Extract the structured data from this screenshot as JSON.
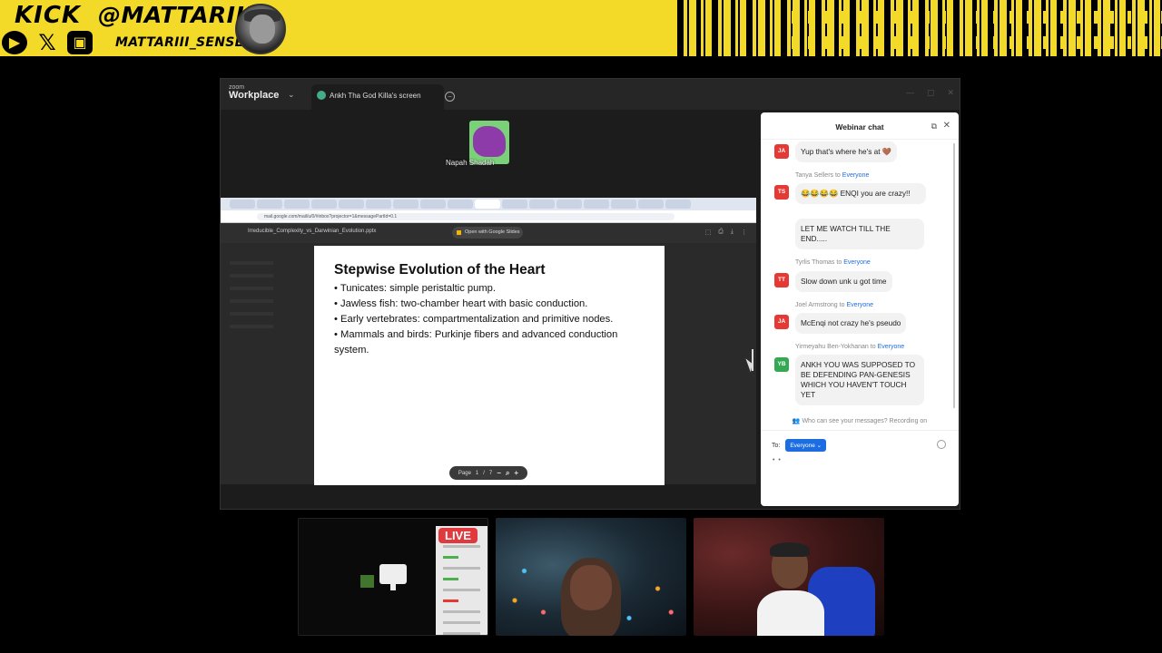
{
  "banner": {
    "platform": "KICK",
    "handle": "@MATTARIII",
    "handle_secondary": "MATTARIII_SENSEI",
    "social_icons": [
      "youtube-icon",
      "x-icon",
      "twitch-icon"
    ],
    "background_color": "#f4da28"
  },
  "zoom": {
    "logo_small": "zoom",
    "logo_big": "Workplace",
    "tab_label": "Ankh Tha God Killa's screen",
    "speaker_name": "Napah Shadah"
  },
  "browser": {
    "url": "mail.google.com/mail/u/0/#inbox?projector=1&messagePartId=0.1",
    "file_name": "Irreducible_Complexity_vs_Darwinian_Evolution.pptx",
    "open_with": "Open with Google Slides"
  },
  "slide": {
    "title": "Stepwise Evolution of the Heart",
    "bullets": [
      "• Tunicates: simple peristaltic pump.",
      "• Jawless fish: two-chamber heart with basic conduction.",
      "• Early vertebrates: compartmentalization and primitive nodes.",
      "• Mammals and birds: Purkinje fibers and advanced conduction system."
    ],
    "pager": {
      "label": "Page",
      "current": "1",
      "separator": "/",
      "total": "7"
    }
  },
  "chat": {
    "title": "Webinar chat",
    "messages": [
      {
        "sender": "",
        "initials": "JA",
        "color": "#e53935",
        "to": "",
        "text": "Yup that's where he's at 🤎"
      },
      {
        "sender": "Tanya Sellers",
        "initials": "TS",
        "color": "#e53935",
        "to": "Everyone",
        "text": "😂😂😂😂 ENQI you are crazy!!"
      },
      {
        "sender": "",
        "initials": "",
        "color": "#e53935",
        "to": "",
        "text": "LET ME WATCH TILL THE END....."
      },
      {
        "sender": "Tyrlis Thomas",
        "initials": "TT",
        "color": "#e53935",
        "to": "Everyone",
        "text": "Slow down unk u got time"
      },
      {
        "sender": "Joel Armstrong",
        "initials": "JA",
        "color": "#e53935",
        "to": "Everyone",
        "text": "McEnqi not crazy he's pseudo"
      },
      {
        "sender": "Yirmeyahu Ben-Yokhanan",
        "initials": "YB",
        "color": "#34a853",
        "to": "Everyone",
        "text": "ANKH YOU WAS SUPPOSED TO BE DEFENDING PAN-GENESIS WHICH YOU HAVEN'T TOUCH YET"
      }
    ],
    "to_word": "to",
    "footer_note": "Who can see your messages? Recording on",
    "to_label": "To:",
    "recipient": "Everyone",
    "typing": "• •"
  },
  "tiles": {
    "live_badge": "LIVE"
  }
}
